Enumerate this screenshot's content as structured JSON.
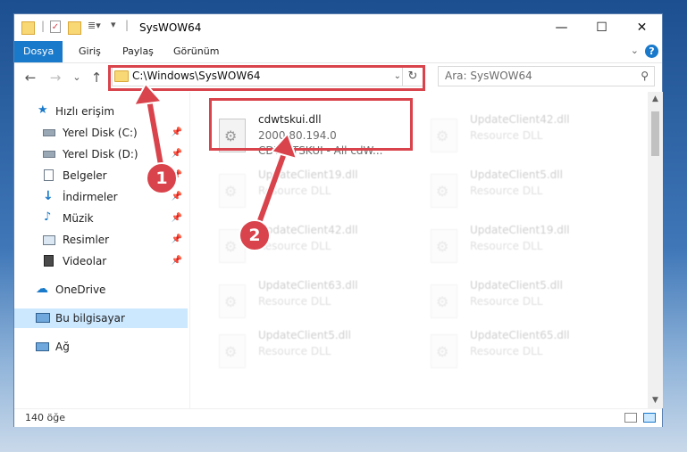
{
  "window": {
    "title": "SysWOW64",
    "controls": {
      "minimize": "—",
      "maximize": "☐",
      "close": "✕"
    }
  },
  "ribbon": {
    "tabs": [
      "Dosya",
      "Giriş",
      "Paylaş",
      "Görünüm"
    ],
    "active_tab": "Dosya",
    "expand_glyph": "⌄",
    "help_glyph": "?"
  },
  "nav": {
    "back_glyph": "←",
    "forward_glyph": "→",
    "recent_glyph": "⌄",
    "up_glyph": "↑",
    "address": "C:\\Windows\\SysWOW64",
    "search_placeholder": "Ara: SysWOW64"
  },
  "sidebar": {
    "items": [
      {
        "label": "Hızlı erişim",
        "icon": "star-icon"
      },
      {
        "label": "Yerel Disk (C:)",
        "icon": "drive-icon",
        "pinned": true
      },
      {
        "label": "Yerel Disk (D:)",
        "icon": "drive-icon",
        "pinned": true
      },
      {
        "label": "Belgeler",
        "icon": "documents-icon",
        "pinned": true
      },
      {
        "label": "İndirmeler",
        "icon": "download-icon",
        "pinned": true
      },
      {
        "label": "Müzik",
        "icon": "music-icon",
        "pinned": true
      },
      {
        "label": "Resimler",
        "icon": "pictures-icon",
        "pinned": true
      },
      {
        "label": "Videolar",
        "icon": "videos-icon",
        "pinned": true
      },
      {
        "label": "OneDrive",
        "icon": "cloud-icon"
      },
      {
        "label": "Bu bilgisayar",
        "icon": "computer-icon",
        "selected": true
      },
      {
        "label": "Ağ",
        "icon": "network-icon"
      }
    ]
  },
  "files": {
    "highlighted": {
      "name": "cdwtskui.dll",
      "version": "2000.80.194.0",
      "description": "CDWCTSKUI - All cdW..."
    },
    "background": [
      {
        "name": "UpdateClient42.dll",
        "type": "Resource DLL"
      },
      {
        "name": "UpdateClient19.dll",
        "type": "Resource DLL"
      },
      {
        "name": "UpdateClient5.dll",
        "type": "Resource DLL"
      },
      {
        "name": "UpdateClient42.dll",
        "type": "Resource DLL"
      },
      {
        "name": "UpdateClient19.dll",
        "type": "Resource DLL"
      },
      {
        "name": "UpdateClient63.dll",
        "type": "Resource DLL"
      },
      {
        "name": "UpdateClient5.dll",
        "type": "Resource DLL"
      },
      {
        "name": "UpdateClient5.dll",
        "type": "Resource DLL"
      },
      {
        "name": "UpdateClient65.dll",
        "type": "Resource DLL"
      }
    ]
  },
  "status": {
    "count": "140 öğe"
  },
  "annotations": {
    "step1": "1",
    "step2": "2"
  },
  "colors": {
    "accent": "#1979ca",
    "highlight": "#d9434b",
    "selected": "#cce8ff"
  }
}
